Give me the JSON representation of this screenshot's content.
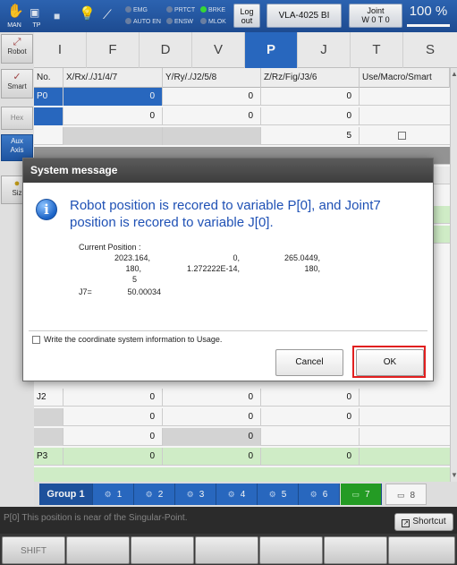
{
  "topbar": {
    "mode_icon_label": "MAN",
    "tp_icon_label": "TP",
    "status": {
      "emg": "EMG",
      "auto_en": "AUTO EN",
      "prtct": "PRTCT",
      "ensw": "ENSW",
      "brke": "BRKE",
      "mlok": "MLOK"
    },
    "logout_label": "Log\nout",
    "robot_model": "VLA-4025 BI",
    "coord_label": "Joint",
    "tool_label": "W 0 T 0",
    "speed_pct": "100 %",
    "speed_fraction": 1.0,
    "colors": {
      "bar": "#2a62b5",
      "accent": "#2a6cc6",
      "on": "#39e039"
    }
  },
  "sidebar": {
    "robot": "Robot",
    "smart": "Smart",
    "hex": "Hex",
    "aux_axis": "Aux\nAxis",
    "size_partial": "Siz"
  },
  "tabs": [
    "I",
    "F",
    "D",
    "V",
    "P",
    "J",
    "T",
    "S"
  ],
  "active_tab": "P",
  "table": {
    "headers": [
      "No.",
      "X/Rx/./J1/4/7",
      "Y/Ry/./J2/5/8",
      "Z/Rz/Fig/J3/6",
      "Use/Macro/Smart"
    ],
    "rows": [
      {
        "name": "P0",
        "c1": "0",
        "c2": "0",
        "c3": "0"
      },
      {
        "name": "",
        "c1": "0",
        "c2": "0",
        "c3": "0"
      },
      {
        "name": "",
        "c1": "",
        "c2": "",
        "c3": "5"
      },
      {
        "name": "J2",
        "c1": "0",
        "c2": "0",
        "c3": "0"
      },
      {
        "name": "",
        "c1": "0",
        "c2": "0",
        "c3": "0"
      },
      {
        "name": "",
        "c1": "0",
        "c2": "0",
        "c3": ""
      },
      {
        "name": "P3",
        "c1": "0",
        "c2": "0",
        "c3": "0"
      }
    ]
  },
  "groupbar": {
    "label": "Group 1",
    "buttons": [
      "1",
      "2",
      "3",
      "4",
      "5",
      "6",
      "7",
      "8"
    ]
  },
  "message_line": "P[0] This position is near of the Singular-Point.",
  "shortcut_label": "Shortcut",
  "fkeys": [
    "SHIFT",
    "",
    "",
    "",
    "",
    "",
    ""
  ],
  "dialog": {
    "title": "System message",
    "message": "Robot position is recored to variable P[0], and Joint7 position is recored to variable J[0].",
    "current_position_label": "Current Position :",
    "values_row1": [
      "2023.164,",
      "0,",
      "265.0449,"
    ],
    "values_row2": [
      "180,",
      "1.272222E-14,",
      "180,"
    ],
    "values_row3": [
      "5"
    ],
    "j7_label": "J7=",
    "j7_value": "50.00034",
    "checkbox_label": "Write the coordinate system information to Usage.",
    "cancel_label": "Cancel",
    "ok_label": "OK"
  }
}
